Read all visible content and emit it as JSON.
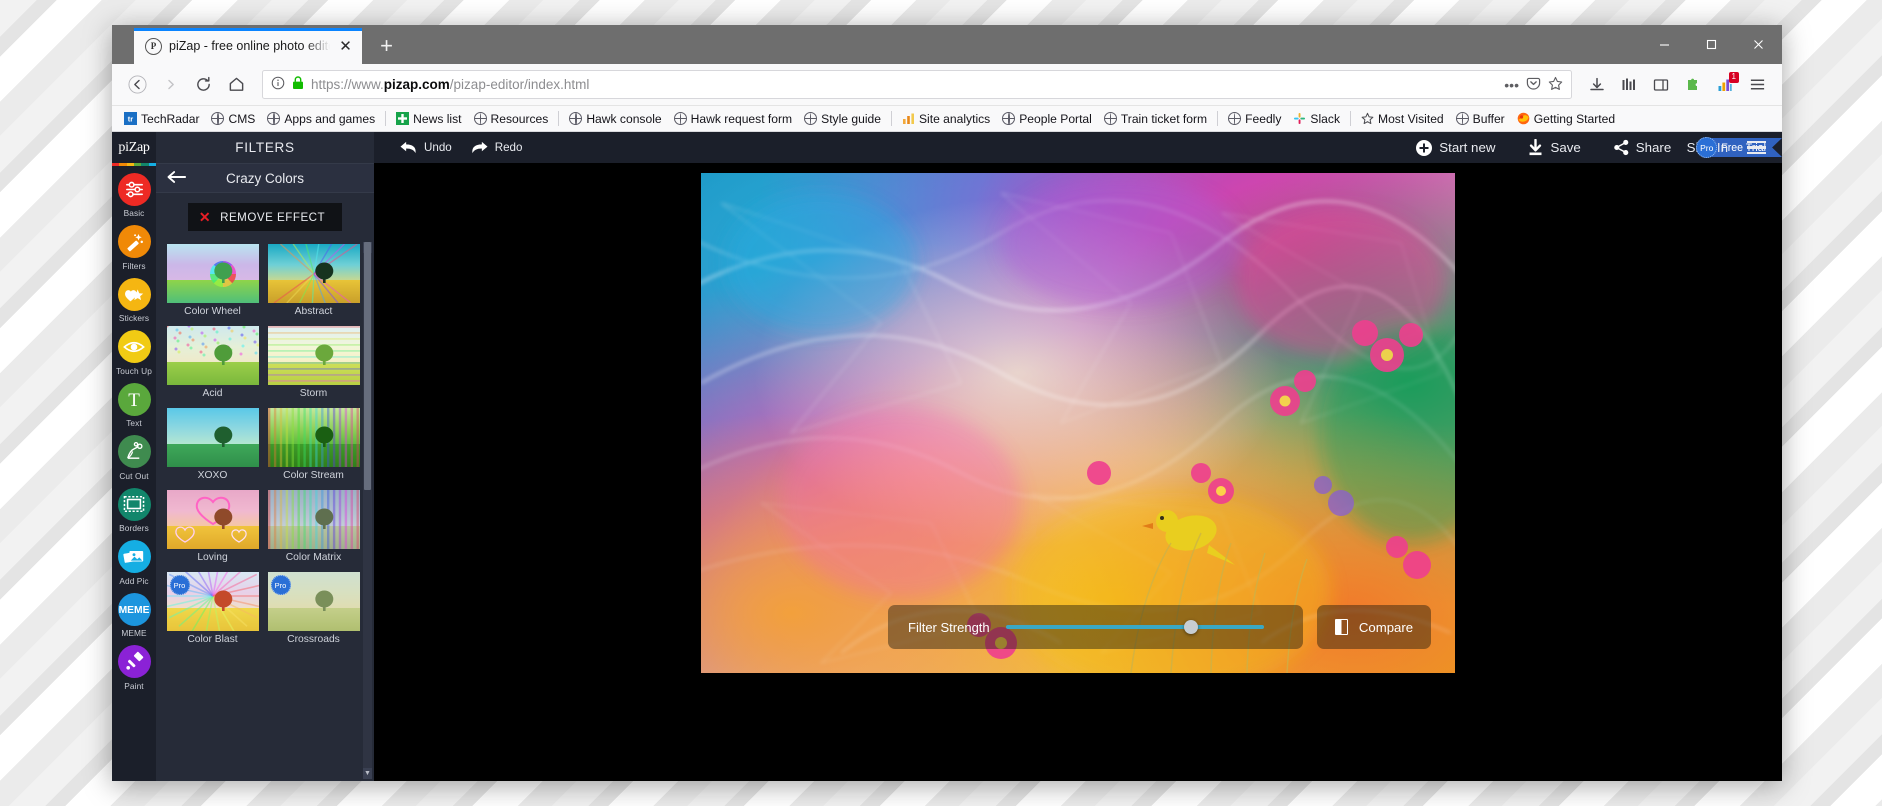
{
  "browser": {
    "tab": {
      "title": "piZap - free online photo editor",
      "favicon_letter": "P",
      "close_icon": "close-icon"
    },
    "newtab_label": "+",
    "window_controls": {
      "minimize": "—",
      "maximize": "▢",
      "close": "✕"
    },
    "nav": {
      "back": "←",
      "forward": "→",
      "reload": "⟳",
      "home": "⌂",
      "url_prefix": "https://www.",
      "url_domain": "pizap.com",
      "url_suffix": "/pizap-editor/index.html",
      "info_icon": "info-icon",
      "lock_icon": "lock-icon",
      "more_icon": "•••",
      "pocket_icon": "pocket-icon",
      "star_icon": "★",
      "downloads_icon": "downloads-icon",
      "library_icon": "library-icon",
      "sidebar_icon": "sidebar-icon",
      "extension_icon": "puzzle-icon",
      "chart_icon": "chart-icon",
      "chart_badge": "1",
      "menu_icon": "hamburger-icon"
    },
    "bookmarks": [
      {
        "label": "TechRadar",
        "icon": "techradar-icon"
      },
      {
        "label": "CMS",
        "icon": "globe-icon"
      },
      {
        "label": "Apps and games",
        "icon": "globe-icon"
      },
      {
        "label": "News list",
        "icon": "news-icon"
      },
      {
        "label": "Resources",
        "icon": "globe-icon"
      },
      {
        "label": "Hawk console",
        "icon": "globe-icon"
      },
      {
        "label": "Hawk request form",
        "icon": "globe-icon"
      },
      {
        "label": "Style guide",
        "icon": "globe-icon"
      },
      {
        "label": "Site analytics",
        "icon": "analytics-icon"
      },
      {
        "label": "People Portal",
        "icon": "globe-icon"
      },
      {
        "label": "Train ticket form",
        "icon": "globe-icon"
      },
      {
        "label": "Feedly",
        "icon": "globe-icon"
      },
      {
        "label": "Slack",
        "icon": "slack-icon"
      },
      {
        "label": "Most Visited",
        "icon": "star-outline-icon"
      },
      {
        "label": "Buffer",
        "icon": "globe-icon"
      },
      {
        "label": "Getting Started",
        "icon": "firefox-icon"
      }
    ]
  },
  "app": {
    "logo": "piZap",
    "rail": [
      {
        "label": "Basic",
        "icon": "sliders-icon",
        "color": "#ee2a24"
      },
      {
        "label": "Filters",
        "icon": "wand-icon",
        "color": "#f08907"
      },
      {
        "label": "Stickers",
        "icon": "heart-star-icon",
        "color": "#f5b612"
      },
      {
        "label": "Touch Up",
        "icon": "eye-icon",
        "color": "#f1cb14"
      },
      {
        "label": "Text",
        "icon": "text-t-icon",
        "color": "#5aa83c"
      },
      {
        "label": "Cut Out",
        "icon": "scissors-icon",
        "color": "#3f8b4f"
      },
      {
        "label": "Borders",
        "icon": "frame-icon",
        "color": "#12866b"
      },
      {
        "label": "Add Pic",
        "icon": "photos-icon",
        "color": "#15aee3"
      },
      {
        "label": "MEME",
        "icon": "meme-icon",
        "color": "#1c95de"
      },
      {
        "label": "Paint",
        "icon": "brush-icon",
        "color": "#8b22d6"
      }
    ],
    "panel": {
      "title": "FILTERS",
      "back_icon": "back-arrow-icon",
      "subtitle": "Crazy Colors",
      "remove_effect": "REMOVE EFFECT",
      "remove_icon": "x-icon",
      "filters": [
        {
          "label": "Color Wheel",
          "pro": false
        },
        {
          "label": "Abstract",
          "pro": false
        },
        {
          "label": "Acid",
          "pro": false
        },
        {
          "label": "Storm",
          "pro": false
        },
        {
          "label": "XOXO",
          "pro": false
        },
        {
          "label": "Color Stream",
          "pro": false
        },
        {
          "label": "Loving",
          "pro": false
        },
        {
          "label": "Color Matrix",
          "pro": false
        },
        {
          "label": "Color Blast",
          "pro": true,
          "pro_label": "Pro"
        },
        {
          "label": "Crossroads",
          "pro": true,
          "pro_label": "Pro"
        }
      ]
    },
    "toolbar": {
      "undo": "Undo",
      "undo_icon": "undo-arrow-icon",
      "redo": "Redo",
      "redo_icon": "redo-arrow-icon",
      "start_new": "Start new",
      "start_new_icon": "plus-circle-icon",
      "save": "Save",
      "save_icon": "download-icon",
      "share": "Share",
      "share_icon": "share-nodes-icon",
      "pro_badge": "Pro",
      "free_trial": "Free Trial",
      "sign_in": "Sign In",
      "menu_icon": "hamburger-icon"
    },
    "canvas": {
      "filter_strength_label": "Filter Strength",
      "filter_strength_value": 72,
      "compare_label": "Compare",
      "compare_icon": "compare-icon"
    }
  }
}
